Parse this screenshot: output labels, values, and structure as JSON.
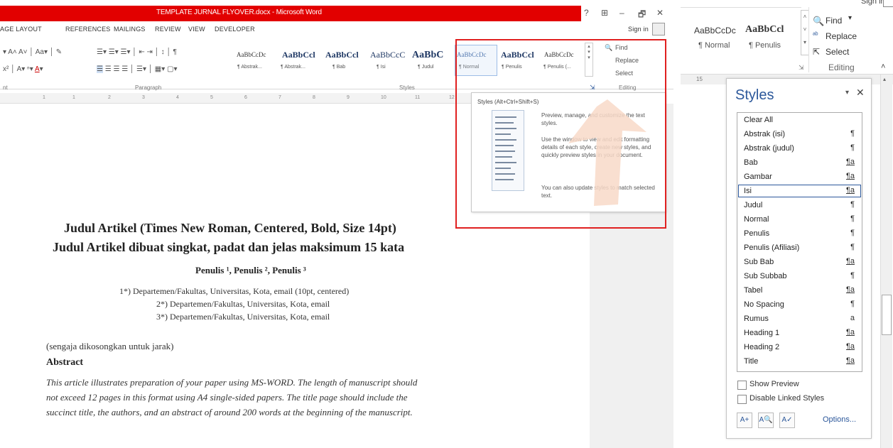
{
  "left": {
    "doc_title": "TEMPLATE JURNAL FLYOVER.docx - Microsoft Word",
    "window_controls": [
      "?",
      "⊞",
      "–",
      "🗗",
      "✕"
    ],
    "sign_in": "Sign in",
    "menu": [
      "AGE LAYOUT",
      "REFERENCES",
      "MAILINGS",
      "REVIEW",
      "VIEW",
      "DEVELOPER"
    ],
    "gallery": {
      "previews": [
        "AaBbCcDc",
        "AaBbCcl",
        "AaBbCcl",
        "AaBbCcC",
        "AaBbC",
        "AaBbCcDc",
        "AaBbCcl",
        "AaBbCcDc"
      ],
      "labels": [
        "¶ Abstrak...",
        "¶ Abstrak...",
        "¶ Bab",
        "¶ Isi",
        "¶ Judul",
        "¶ Normal",
        "¶ Penulis",
        "¶ Penulis (..."
      ]
    },
    "editing": {
      "find": "Find",
      "replace": "Replace",
      "select": "Select"
    },
    "group_labels": {
      "font": "nt",
      "paragraph": "Paragraph",
      "styles": "Styles",
      "editing": "Editing"
    },
    "tooltip": {
      "title": "Styles (Alt+Ctrl+Shift+S)",
      "para1": "Preview, manage, and customize the text styles.",
      "para2": "Use the window to view and edit formatting details of each style, create new styles, and quickly preview styles in your document.",
      "para3": "You can also update styles to match selected text."
    },
    "document": {
      "title1": "Judul Artikel (Times New Roman, Centered, Bold, Size 14pt)",
      "title2": "Judul Artikel dibuat singkat, padat dan jelas maksimum 15 kata",
      "authors": "Penulis ¹, Penulis ², Penulis ³",
      "affil1": "1*) Departemen/Fakultas, Universitas, Kota, email (10pt, centered)",
      "affil2": "2*) Departemen/Fakultas, Universitas, Kota, email",
      "affil3": "3*) Departemen/Fakultas, Universitas, Kota, email",
      "spacer_note": "(sengaja dikosongkan untuk jarak)",
      "abstract_heading": "Abstract",
      "abstract_line1": "This article illustrates preparation of your paper using MS-WORD. The length of manuscript should",
      "abstract_line2": "not exceed 12 pages in this format using A4 single-sided papers. The title page should include the",
      "abstract_line3": "succinct title, the authors, and an abstract of around 200 words at the beginning of the manuscript."
    }
  },
  "right": {
    "sign_in": "Sign in",
    "ribbon": {
      "preview1": "AaBbCcDc",
      "preview2": "AaBbCcl",
      "label1": "¶ Normal",
      "label2": "¶ Penulis",
      "find": "Find",
      "replace": "Replace",
      "select": "Select",
      "editing_group": "Editing"
    },
    "ruler_num": "15",
    "styles_pane": {
      "title": "Styles",
      "items": [
        {
          "name": "Clear All",
          "icon": ""
        },
        {
          "name": "Abstrak (isi)",
          "icon": "¶"
        },
        {
          "name": "Abstrak (judul)",
          "icon": "¶"
        },
        {
          "name": "Bab",
          "icon": "¶a"
        },
        {
          "name": "Gambar",
          "icon": "¶a"
        },
        {
          "name": "Isi",
          "icon": "¶a"
        },
        {
          "name": "Judul",
          "icon": "¶"
        },
        {
          "name": "Normal",
          "icon": "¶"
        },
        {
          "name": "Penulis",
          "icon": "¶"
        },
        {
          "name": "Penulis (Afiliasi)",
          "icon": "¶"
        },
        {
          "name": "Sub Bab",
          "icon": "¶a"
        },
        {
          "name": "Sub Subbab",
          "icon": "¶"
        },
        {
          "name": "Tabel",
          "icon": "¶a"
        },
        {
          "name": "No Spacing",
          "icon": "¶"
        },
        {
          "name": "Rumus",
          "icon": "a"
        },
        {
          "name": "Heading 1",
          "icon": "¶a"
        },
        {
          "name": "Heading 2",
          "icon": "¶a"
        },
        {
          "name": "Title",
          "icon": "¶a"
        }
      ],
      "selected_index": 5,
      "show_preview": "Show Preview",
      "disable_linked": "Disable Linked Styles",
      "options": "Options..."
    },
    "accent_color": "#2b579a"
  }
}
